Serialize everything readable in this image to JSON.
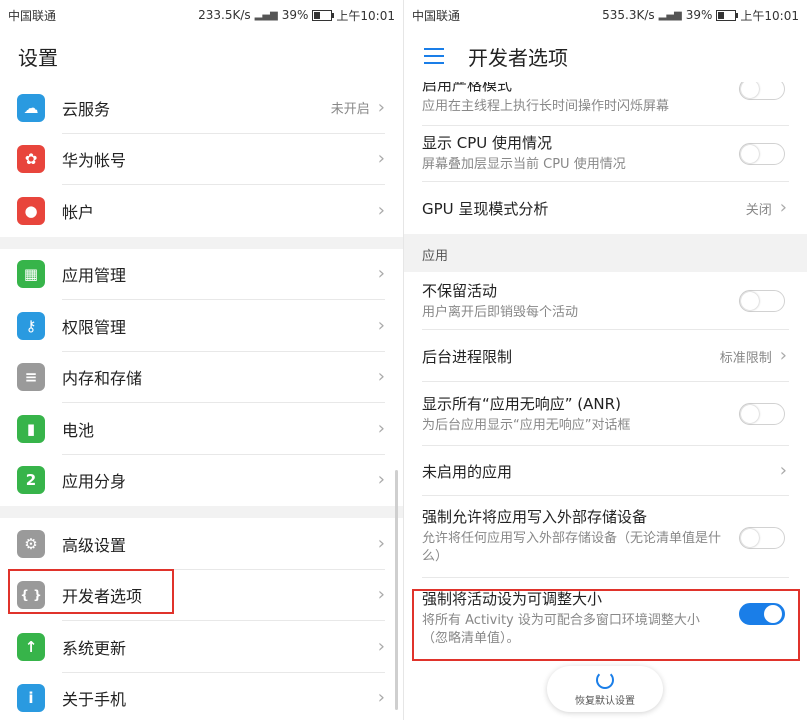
{
  "left": {
    "status": {
      "carrier": "中国联通",
      "speed": "233.5K/s",
      "signal": "46",
      "battery": "39%",
      "time": "上午10:01"
    },
    "title": "设置",
    "groups": [
      [
        {
          "label": "云服务",
          "value": "未开启",
          "icon": "cloud-icon",
          "color": "#2a9ae0"
        },
        {
          "label": "华为帐号",
          "value": "",
          "icon": "huawei-logo-icon",
          "color": "#e8453c"
        },
        {
          "label": "帐户",
          "value": "",
          "icon": "person-icon",
          "color": "#e8453c"
        }
      ],
      [
        {
          "label": "应用管理",
          "value": "",
          "icon": "grid-apps-icon",
          "color": "#37b44a"
        },
        {
          "label": "权限管理",
          "value": "",
          "icon": "key-icon",
          "color": "#2a9ae0"
        },
        {
          "label": "内存和存储",
          "value": "",
          "icon": "storage-icon",
          "color": "#9a9a9a"
        },
        {
          "label": "电池",
          "value": "",
          "icon": "battery-icon",
          "color": "#37b44a"
        },
        {
          "label": "应用分身",
          "value": "",
          "icon": "app-clone-icon",
          "color": "#37b44a"
        }
      ],
      [
        {
          "label": "高级设置",
          "value": "",
          "icon": "gear-icon",
          "color": "#9a9a9a"
        },
        {
          "label": "开发者选项",
          "value": "",
          "icon": "braces-icon",
          "color": "#9a9a9a"
        },
        {
          "label": "系统更新",
          "value": "",
          "icon": "update-icon",
          "color": "#37b44a"
        },
        {
          "label": "关于手机",
          "value": "",
          "icon": "info-icon",
          "color": "#2a9ae0"
        }
      ]
    ]
  },
  "right": {
    "status": {
      "carrier": "中国联通",
      "speed": "535.3K/s",
      "signal": "46",
      "battery": "39%",
      "time": "上午10:01"
    },
    "title": "开发者选项",
    "top_partial": {
      "title": "启用严格模式",
      "sub": "应用在主线程上执行长时间操作时闪烁屏幕"
    },
    "show_cpu": {
      "title": "显示 CPU 使用情况",
      "sub": "屏幕叠加层显示当前 CPU 使用情况"
    },
    "gpu": {
      "title": "GPU 呈现模式分析",
      "value": "关闭"
    },
    "section_apps": "应用",
    "dont_keep": {
      "title": "不保留活动",
      "sub": "用户离开后即销毁每个活动"
    },
    "bg_limit": {
      "title": "后台进程限制",
      "value": "标准限制"
    },
    "show_anr": {
      "title": "显示所有“应用无响应” (ANR)",
      "sub": "为后台应用显示“应用无响应”对话框"
    },
    "inactive_apps": {
      "title": "未启用的应用"
    },
    "force_external": {
      "title": "强制允许将应用写入外部存储设备",
      "sub": "允许将任何应用写入外部存储设备（无论清单值是什么）"
    },
    "force_resizable": {
      "title": "强制将活动设为可调整大小",
      "sub": "将所有 Activity 设为可配合多窗口环境调整大小（忽略清单值）。"
    },
    "restore_label": "恢复默认设置"
  },
  "colors": {
    "accent": "#1a7ee8",
    "highlight": "#e0332b"
  }
}
